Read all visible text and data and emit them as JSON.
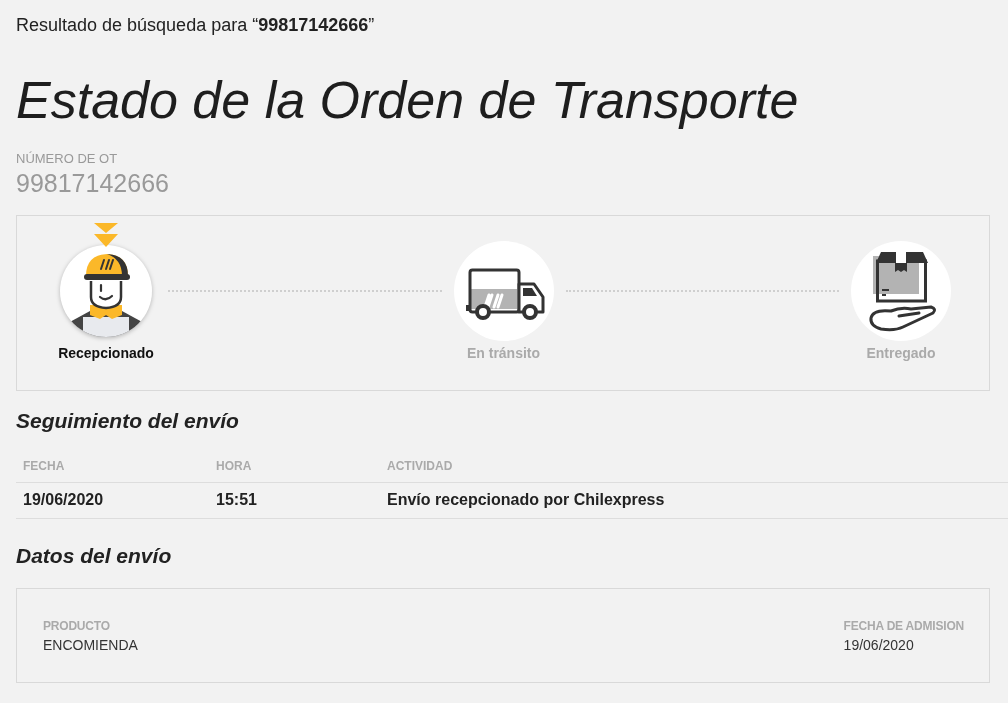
{
  "search_result": {
    "text": "Resultado de búsqueda para “**99817142666**”"
  },
  "title": "Estado de la Orden de Transporte",
  "order_number": {
    "label": "NÚMERO DE OT",
    "value": "99817142666"
  },
  "steps": [
    {
      "kind": "received",
      "label": "Recepcionado",
      "current": true
    },
    {
      "kind": "transit",
      "label": "En tránsito",
      "current": false
    },
    {
      "kind": "delivered",
      "label": "Entregado",
      "current": false
    }
  ],
  "tracking": {
    "title": "Seguimiento del envío",
    "columns": [
      "FECHA",
      "HORA",
      "ACTIVIDAD"
    ],
    "rows": [
      [
        "19/06/2020",
        "15:51",
        "Envío recepcionado por Chilexpress"
      ]
    ]
  },
  "shipment": {
    "title": "Datos del envío",
    "fields": [
      {
        "label": "PRODUCTO",
        "value": "ENCOMIENDA"
      },
      {
        "label": "FECHA DE ADMISION",
        "value": "19/06/2020"
      }
    ]
  }
}
